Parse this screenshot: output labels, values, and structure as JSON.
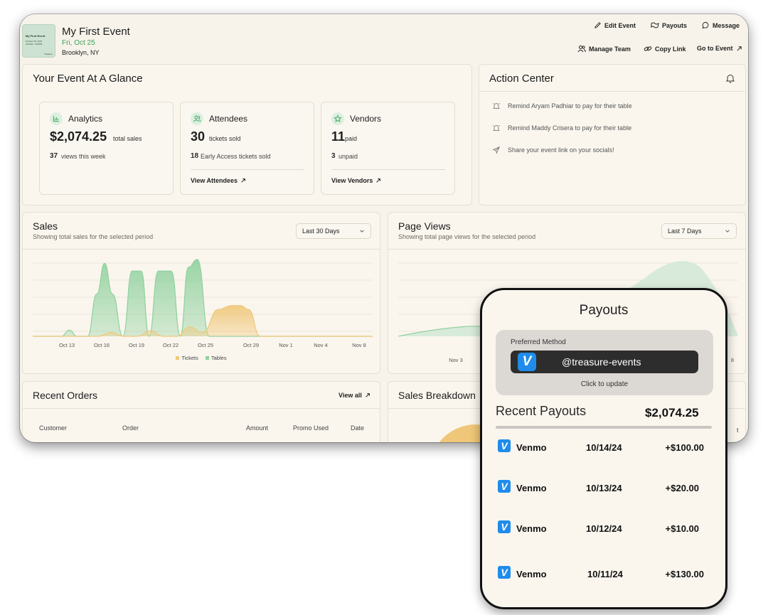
{
  "event": {
    "thumb_title": "My First Event",
    "thumb_line1": "October 25, 2024",
    "thumb_line2": "9:00AM - 5:00PM",
    "thumb_brand": "Treasure",
    "name": "My First Event",
    "date": "Fri, Oct 25",
    "location": "Brooklyn, NY"
  },
  "header_actions": {
    "edit_event": "Edit Event",
    "payouts": "Payouts",
    "message": "Message",
    "manage_team": "Manage Team",
    "copy_link": "Copy Link",
    "go_to_event": "Go to Event"
  },
  "glance": {
    "title": "Your Event At A Glance",
    "analytics": {
      "label": "Analytics",
      "value": "$2,074.25",
      "value_suffix": "total sales",
      "stat": "37",
      "stat_text": "views this week"
    },
    "attendees": {
      "label": "Attendees",
      "value": "30",
      "value_suffix": "tickets sold",
      "stat": "18",
      "stat_text": "Early Access tickets sold",
      "link": "View Attendees"
    },
    "vendors": {
      "label": "Vendors",
      "value": "11",
      "value_suffix": "paid",
      "stat": "3",
      "stat_text": "unpaid",
      "link": "View Vendors"
    }
  },
  "action_center": {
    "title": "Action Center",
    "items": [
      "Remind Aryam Padhiar to pay for their table",
      "Remind Maddy Crisera to pay for their table",
      "Share your event link on your socials!"
    ]
  },
  "sales": {
    "title": "Sales",
    "subtitle": "Showing total sales for the selected period",
    "period": "Last 30 Days",
    "legend": [
      "Tickets",
      "Tables"
    ]
  },
  "page_views": {
    "title": "Page Views",
    "subtitle": "Showing total page views for the selected period",
    "period": "Last 7 Days",
    "visible_ticks": [
      "Nov 3",
      "8"
    ]
  },
  "recent_orders": {
    "title": "Recent Orders",
    "view_all": "View all",
    "columns": [
      "Customer",
      "Order",
      "Amount",
      "Promo Used",
      "Date"
    ]
  },
  "sales_breakdown": {
    "title": "Sales Breakdown",
    "edge_label": "t"
  },
  "chart_data": {
    "type": "area",
    "categories": [
      "Oct 13",
      "Oct 16",
      "Oct 19",
      "Oct 22",
      "Oct 25",
      "Oct 29",
      "Nov 1",
      "Nov 4",
      "Nov 8"
    ],
    "series": [
      {
        "name": "Tables",
        "color": "#8fd19e",
        "x": [
          0,
          2.2,
          2.8,
          3.4,
          4.2,
          4.9,
          5.5,
          6.1,
          6.9,
          7.6,
          8.3,
          8.9,
          9.6,
          10.6,
          11.3,
          11.9,
          12.6,
          13.5,
          14.2,
          14.8,
          15.8,
          17.0,
          26
        ],
        "values": [
          0,
          0,
          0.08,
          0,
          0,
          0.55,
          0.95,
          0.55,
          0,
          0.85,
          0.85,
          0,
          0.85,
          0.85,
          0,
          0.9,
          1.0,
          0,
          0,
          0,
          0,
          0,
          0
        ]
      },
      {
        "name": "Tickets",
        "color": "#f0c778",
        "x": [
          0,
          5.0,
          6.0,
          7.0,
          8.0,
          9.0,
          10.0,
          11.0,
          12.0,
          13.0,
          14.2,
          15.2,
          15.9,
          16.5,
          17.4,
          26
        ],
        "values": [
          0,
          0,
          0.05,
          0,
          0,
          0.07,
          0,
          0,
          0.12,
          0.05,
          0.35,
          0.4,
          0.4,
          0.35,
          0,
          0
        ]
      }
    ],
    "ylim": [
      0,
      1
    ],
    "grid": true,
    "legend_position": "bottom"
  },
  "payouts": {
    "title": "Payouts",
    "preferred_label": "Preferred Method",
    "preferred_handle": "@treasure-events",
    "click_to_update": "Click to update",
    "recent_title": "Recent Payouts",
    "total": "$2,074.25",
    "rows": [
      {
        "method": "Venmo",
        "date": "10/14/24",
        "amount": "+$100.00"
      },
      {
        "method": "Venmo",
        "date": "10/13/24",
        "amount": "+$20.00"
      },
      {
        "method": "Venmo",
        "date": "10/12/24",
        "amount": "+$10.00"
      },
      {
        "method": "Venmo",
        "date": "10/11/24",
        "amount": "+$130.00"
      }
    ]
  },
  "colors": {
    "accent_green": "#3aa45a",
    "tables_green": "#8fd19e",
    "tickets_yellow": "#f0c778",
    "venmo_blue": "#1f8ceb"
  }
}
